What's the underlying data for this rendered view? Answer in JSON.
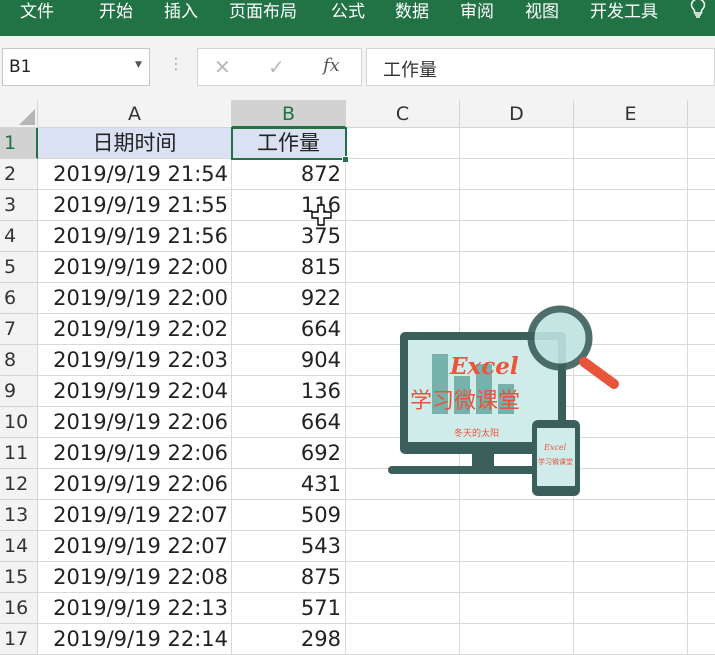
{
  "ribbon": {
    "tabs": [
      "文件",
      "开始",
      "插入",
      "页面布局",
      "公式",
      "数据",
      "审阅",
      "视图",
      "开发工具"
    ],
    "help_icon": "lightbulb-icon"
  },
  "formula_bar": {
    "name_box": "B1",
    "cancel_icon": "✕",
    "enter_icon": "✓",
    "fx_label": "fx",
    "content": "工作量"
  },
  "columns": [
    "A",
    "B",
    "C",
    "D",
    "E"
  ],
  "rows": [
    {
      "num": "1",
      "a": "日期时间",
      "b": "工作量"
    },
    {
      "num": "2",
      "a": "2019/9/19 21:54",
      "b": "872"
    },
    {
      "num": "3",
      "a": "2019/9/19 21:55",
      "b": "116"
    },
    {
      "num": "4",
      "a": "2019/9/19 21:56",
      "b": "375"
    },
    {
      "num": "5",
      "a": "2019/9/19 22:00",
      "b": "815"
    },
    {
      "num": "6",
      "a": "2019/9/19 22:00",
      "b": "922"
    },
    {
      "num": "7",
      "a": "2019/9/19 22:02",
      "b": "664"
    },
    {
      "num": "8",
      "a": "2019/9/19 22:03",
      "b": "904"
    },
    {
      "num": "9",
      "a": "2019/9/19 22:04",
      "b": "136"
    },
    {
      "num": "10",
      "a": "2019/9/19 22:06",
      "b": "664"
    },
    {
      "num": "11",
      "a": "2019/9/19 22:06",
      "b": "692"
    },
    {
      "num": "12",
      "a": "2019/9/19 22:06",
      "b": "431"
    },
    {
      "num": "13",
      "a": "2019/9/19 22:07",
      "b": "509"
    },
    {
      "num": "14",
      "a": "2019/9/19 22:07",
      "b": "543"
    },
    {
      "num": "15",
      "a": "2019/9/19 22:08",
      "b": "875"
    },
    {
      "num": "16",
      "a": "2019/9/19 22:13",
      "b": "571"
    },
    {
      "num": "17",
      "a": "2019/9/19 22:14",
      "b": "298"
    }
  ],
  "watermark": {
    "title": "Excel",
    "subtitle": "学习微课堂",
    "author": "冬天的太阳",
    "phone_title": "Excel",
    "phone_subtitle": "学习微课堂"
  },
  "colors": {
    "ribbon": "#217346",
    "selection": "#217346",
    "header_fill": "#d9e1f2",
    "logo_dark": "#3b5f5a",
    "logo_accent": "#e8553b"
  }
}
